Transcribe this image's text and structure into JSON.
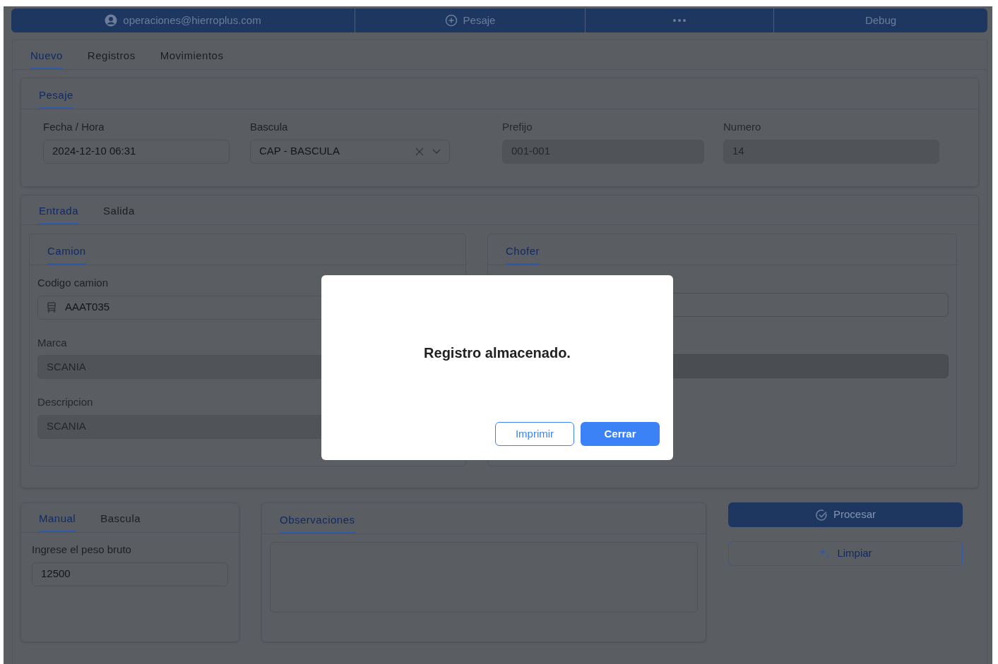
{
  "top_bar": {
    "items": [
      {
        "kind": "user",
        "label": "operaciones@hierroplus.com"
      },
      {
        "kind": "add",
        "label": "Pesaje"
      },
      {
        "kind": "more"
      },
      {
        "kind": "plain",
        "label": "Debug"
      }
    ]
  },
  "tabs": [
    {
      "label": "Nuevo",
      "selected": true
    },
    {
      "label": "Registros",
      "selected": false
    },
    {
      "label": "Movimientos",
      "selected": false
    }
  ],
  "pesaje": {
    "title": "Pesaje",
    "fields": [
      {
        "kind": "text",
        "label": "Fecha / Hora",
        "value": "2024-12-10 06:31",
        "disabled": false
      },
      {
        "kind": "select",
        "label": "Bascula",
        "value": "CAP - BASCULA",
        "disabled": false
      },
      {
        "kind": "text",
        "label": "Prefijo",
        "value": "001-001",
        "disabled": true
      },
      {
        "kind": "text",
        "label": "Numero",
        "value": "14",
        "disabled": true
      }
    ]
  },
  "direction_tabs": [
    {
      "label": "Entrada",
      "selected": true
    },
    {
      "label": "Salida",
      "selected": false
    }
  ],
  "camion": {
    "title": "Camion",
    "fields": [
      {
        "kind": "truck",
        "label": "Codigo camion",
        "value": "AAAT035",
        "disabled": false
      },
      {
        "kind": "text",
        "label": "Marca",
        "value": "SCANIA",
        "disabled": true
      },
      {
        "kind": "text",
        "label": "Descripcion",
        "value": "SCANIA",
        "disabled": true
      }
    ]
  },
  "chofer": {
    "title": "Chofer",
    "fields": [
      {
        "disabled": false
      },
      {
        "disabled": true
      }
    ]
  },
  "weight": {
    "tabs": [
      {
        "label": "Manual",
        "selected": true
      },
      {
        "label": "Bascula",
        "selected": false
      }
    ],
    "label": "Ingrese el peso bruto",
    "value": "12500"
  },
  "observaciones": {
    "title": "Observaciones"
  },
  "actions": [
    {
      "kind": "primary",
      "label": "Procesar"
    },
    {
      "kind": "outline",
      "label": "Limpiar"
    }
  ],
  "dialog": {
    "message": "Registro almacenado.",
    "buttons": [
      {
        "kind": "outline",
        "label": "Imprimir"
      },
      {
        "kind": "primary",
        "label": "Cerrar"
      }
    ]
  }
}
